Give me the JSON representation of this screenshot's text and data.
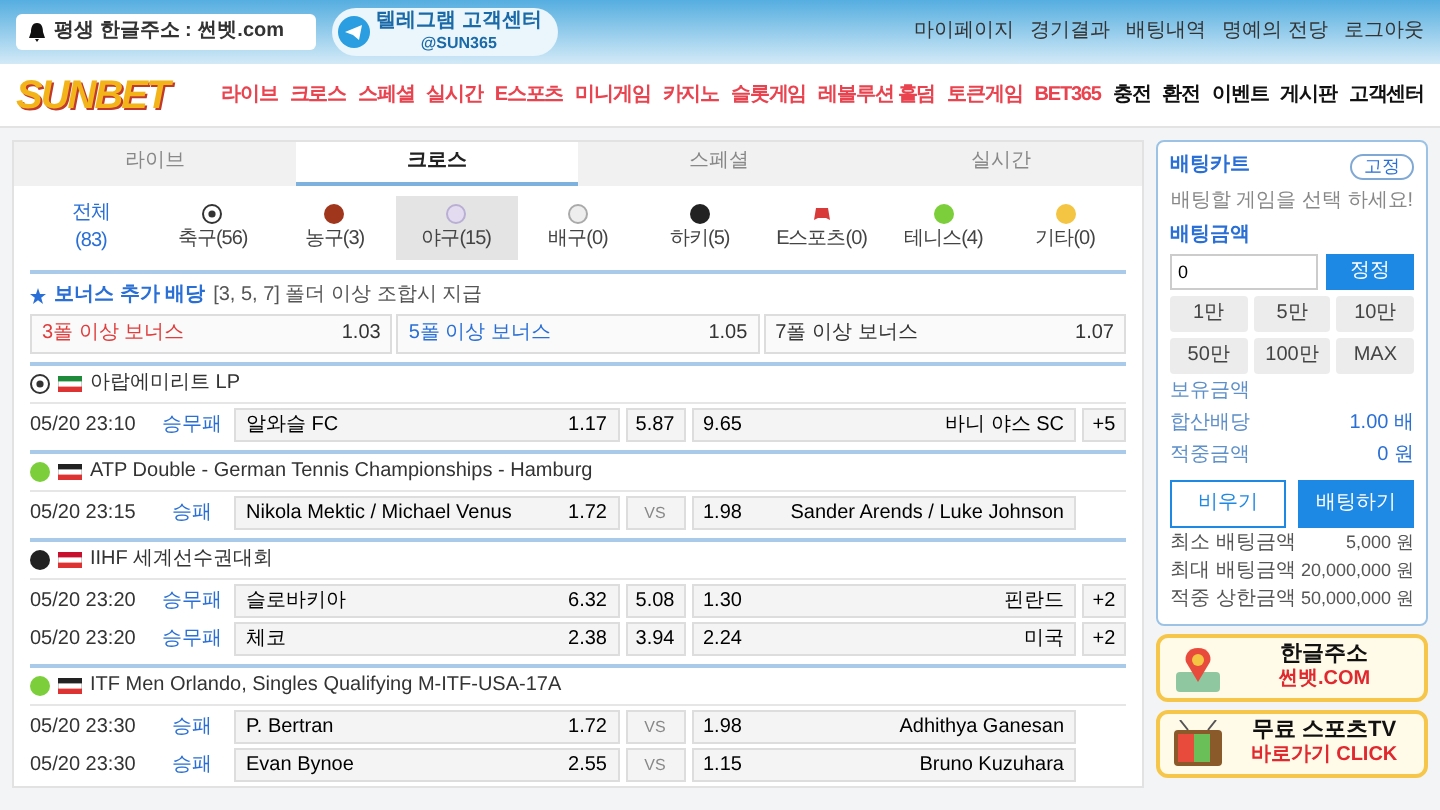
{
  "header": {
    "address": "평생 한글주소 : 썬벳.com",
    "telegram": {
      "title": "텔레그램 고객센터",
      "handle": "@SUN365"
    },
    "top_links": [
      "마이페이지",
      "경기결과",
      "배팅내역",
      "명예의 전당",
      "로그아웃"
    ],
    "logo": "SUNBET",
    "nav": [
      {
        "label": "라이브",
        "color": "#e8434f"
      },
      {
        "label": "크로스",
        "color": "#e8434f"
      },
      {
        "label": "스페셜",
        "color": "#e8434f"
      },
      {
        "label": "실시간",
        "color": "#e8434f"
      },
      {
        "label": "E스포츠",
        "color": "#e8434f"
      },
      {
        "label": "미니게임",
        "color": "#e8434f"
      },
      {
        "label": "카지노",
        "color": "#e8434f"
      },
      {
        "label": "슬롯게임",
        "color": "#e8434f"
      },
      {
        "label": "레볼루션 홀덤",
        "color": "#e8434f"
      },
      {
        "label": "토큰게임",
        "color": "#e8434f"
      },
      {
        "label": "BET365",
        "color": "#e8434f"
      },
      {
        "label": "충전",
        "color": "#111111"
      },
      {
        "label": "환전",
        "color": "#111111"
      },
      {
        "label": "이벤트",
        "color": "#111111"
      },
      {
        "label": "게시판",
        "color": "#111111"
      },
      {
        "label": "고객센터",
        "color": "#111111"
      }
    ]
  },
  "tabs": [
    {
      "label": "라이브",
      "selected": false
    },
    {
      "label": "크로스",
      "selected": true
    },
    {
      "label": "스페셜",
      "selected": false
    },
    {
      "label": "실시간",
      "selected": false
    }
  ],
  "sports": [
    {
      "kind": "all",
      "label": "전체",
      "count": "(83)",
      "selected": false
    },
    {
      "kind": "soccer",
      "label": "축구(56)",
      "selected": false
    },
    {
      "kind": "basketball",
      "label": "농구(3)",
      "selected": false
    },
    {
      "kind": "baseball",
      "label": "야구(15)",
      "selected": true
    },
    {
      "kind": "volleyball",
      "label": "배구(0)",
      "selected": false
    },
    {
      "kind": "hockey",
      "label": "하키(5)",
      "selected": false
    },
    {
      "kind": "esports",
      "label": "E스포츠(0)",
      "selected": false
    },
    {
      "kind": "tennis",
      "label": "테니스(4)",
      "selected": false
    },
    {
      "kind": "other",
      "label": "기타(0)",
      "selected": false
    }
  ],
  "bonus": {
    "title": "보너스 추가 배당",
    "note": "[3, 5, 7] 폴더 이상 조합시 지급",
    "items": [
      {
        "label": "3폴 이상 보너스",
        "odds": "1.03",
        "color": "#e03c3c"
      },
      {
        "label": "5폴 이상 보너스",
        "odds": "1.05",
        "color": "#2a6fd6"
      },
      {
        "label": "7폴 이상 보너스",
        "odds": "1.07",
        "color": "#333333"
      }
    ]
  },
  "leagues": [
    {
      "kind": "soccer",
      "name": "아랍에미리트 LP",
      "matches": [
        {
          "kind": "threeway",
          "time": "05/20 23:10",
          "market": "승무패",
          "home": "알와슬 FC",
          "home_odds": "1.17",
          "draw": "5.87",
          "away_odds": "9.65",
          "away": "바니 야스 SC",
          "more": "+5"
        }
      ]
    },
    {
      "kind": "tennis",
      "name": "ATP Double - German Tennis Championships - Hamburg",
      "matches": [
        {
          "kind": "twoway",
          "time": "05/20 23:15",
          "market": "승패",
          "home": "Nikola Mektic / Michael Venus",
          "home_odds": "1.72",
          "draw": "VS",
          "away_odds": "1.98",
          "away": "Sander Arends / Luke Johnson"
        }
      ]
    },
    {
      "kind": "hockey",
      "name": "IIHF 세계선수권대회",
      "matches": [
        {
          "kind": "threeway",
          "time": "05/20 23:20",
          "market": "승무패",
          "home": "슬로바키아",
          "home_odds": "6.32",
          "draw": "5.08",
          "away_odds": "1.30",
          "away": "핀란드",
          "more": "+2"
        },
        {
          "kind": "threeway",
          "time": "05/20 23:20",
          "market": "승무패",
          "home": "체코",
          "home_odds": "2.38",
          "draw": "3.94",
          "away_odds": "2.24",
          "away": "미국",
          "more": "+2"
        }
      ]
    },
    {
      "kind": "tennis",
      "name": "ITF Men Orlando, Singles Qualifying M-ITF-USA-17A",
      "matches": [
        {
          "kind": "twoway",
          "time": "05/20 23:30",
          "market": "승패",
          "home": "P. Bertran",
          "home_odds": "1.72",
          "draw": "VS",
          "away_odds": "1.98",
          "away": "Adhithya Ganesan"
        },
        {
          "kind": "twoway",
          "time": "05/20 23:30",
          "market": "승패",
          "home": "Evan Bynoe",
          "home_odds": "2.55",
          "draw": "VS",
          "away_odds": "1.15",
          "away": "Bruno Kuzuhara"
        }
      ]
    }
  ],
  "slip": {
    "title": "배팅카트",
    "fixed_button": "고정",
    "empty_message": "배팅할 게임을 선택 하세요!",
    "amount_label": "배팅금액",
    "amount_value": "0",
    "confirm_button": "정정",
    "chips": [
      "1만",
      "5만",
      "10만",
      "50만",
      "100만",
      "MAX"
    ],
    "info": [
      {
        "label": "보유금액"
      },
      {
        "label": "합산배당",
        "value": "1.00 배"
      },
      {
        "label": "적중금액",
        "value": "0 원"
      }
    ],
    "clear_button": "비우기",
    "bet_button": "배팅하기",
    "limits": [
      {
        "label": "최소 배팅금액",
        "value": "5,000 원"
      },
      {
        "label": "최대 배팅금액",
        "value": "20,000,000 원"
      },
      {
        "label": "적중 상한금액",
        "value": "50,000,000 원"
      }
    ]
  },
  "banners": [
    {
      "kind": "address",
      "title": "한글주소",
      "subtitle": "썬뱃.COM"
    },
    {
      "kind": "tv",
      "title": "무료 스포츠TV",
      "subtitle": "바로가기 CLICK"
    }
  ]
}
